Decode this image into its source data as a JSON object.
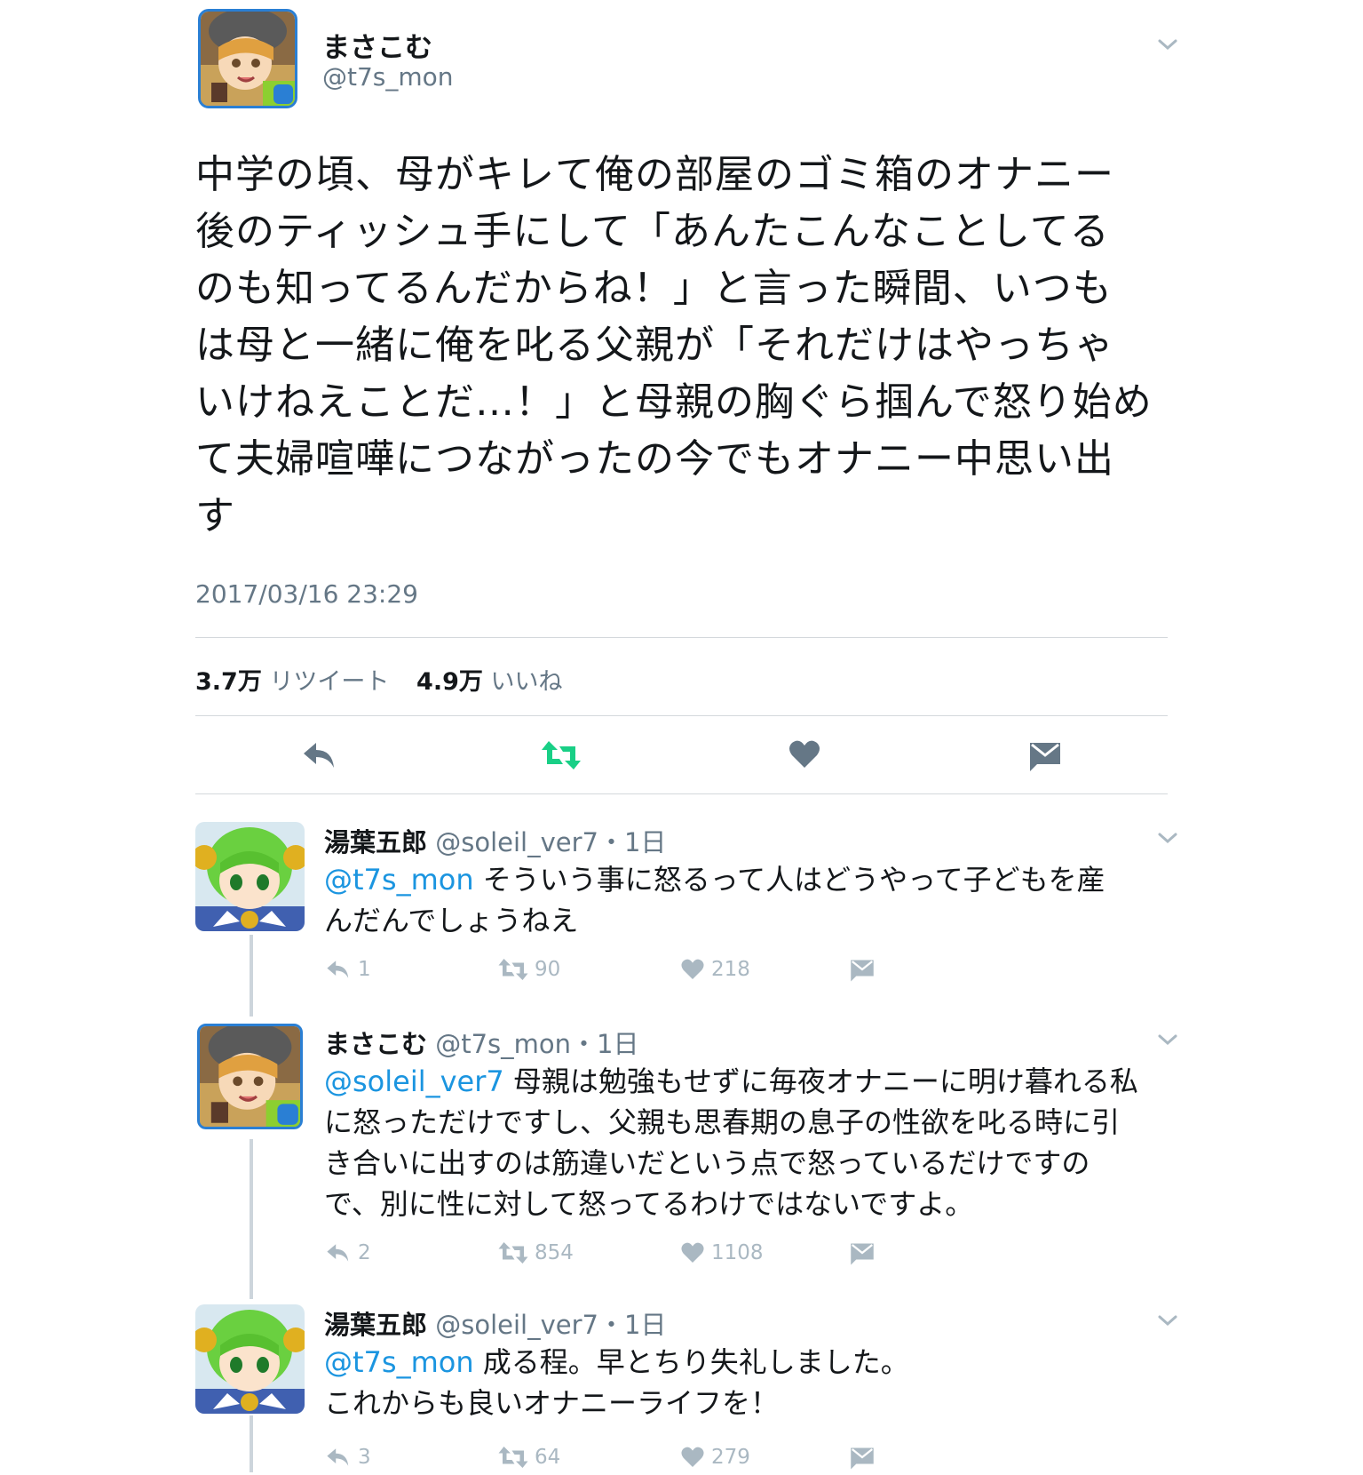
{
  "main_tweet": {
    "author_name": "まさこむ",
    "author_handle": "@t7s_mon",
    "text_lines": [
      "中学の頃、母がキレて俺の部屋のゴミ箱のオナニー",
      "後のティッシュ手にして「あんたこんなことしてる",
      "のも知ってるんだからね！」と言った瞬間、いつも",
      "は母と一緒に俺を叱る父親が「それだけはやっちゃ",
      "いけねえことだ…！」と母親の胸ぐら掴んで怒り始め",
      "て夫婦喧嘩につながったの今でもオナニー中思い出",
      "す"
    ],
    "timestamp": "2017/03/16 23:29",
    "retweet_count": "3.7万",
    "retweet_label": "リツイート",
    "like_count": "4.9万",
    "like_label": "いいね",
    "icons": [
      "reply-icon",
      "retweet-icon",
      "like-icon",
      "dm-icon"
    ],
    "retweet_icon_color": "#19cf86"
  },
  "replies": [
    {
      "author_name": "湯葉五郎",
      "author_handle": "@soleil_ver7",
      "time": "・1日",
      "mention": "@t7s_mon",
      "text_lines": [
        " そういう事に怒るって人はどうやって子どもを産",
        "んだんでしょうねえ"
      ],
      "reply_count": "1",
      "retweet_count": "90",
      "like_count": "218"
    },
    {
      "author_name": "まさこむ",
      "author_handle": "@t7s_mon",
      "time": "・1日",
      "mention": "@soleil_ver7",
      "text_lines": [
        " 母親は勉強もせずに毎夜オナニーに明け暮れる私",
        "に怒っただけですし、父親も思春期の息子の性欲を叱る時に引",
        "き合いに出すのは筋違いだという点で怒っているだけですの",
        "で、別に性に対して怒ってるわけではないですよ。"
      ],
      "reply_count": "2",
      "retweet_count": "854",
      "like_count": "1108"
    },
    {
      "author_name": "湯葉五郎",
      "author_handle": "@soleil_ver7",
      "time": "・1日",
      "mention": "@t7s_mon",
      "text_lines": [
        " 成る程。早とちり失礼しました。",
        "これからも良いオナニーライフを！"
      ],
      "reply_count": "3",
      "retweet_count": "64",
      "like_count": "279"
    }
  ],
  "colors": {
    "text": "#14171a",
    "secondary": "#657786",
    "mention": "#1b95e0",
    "action_gray": "#aab8c2",
    "main_icon_gray": "#657786",
    "avatar_border": "#2a7fd4"
  }
}
